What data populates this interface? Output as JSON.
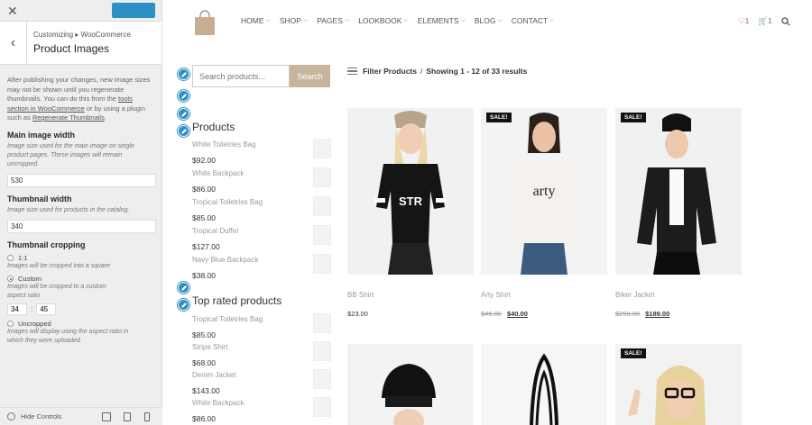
{
  "customizer": {
    "breadcrumb": "Customizing ▸ WooCommerce",
    "section_title": "Product Images",
    "notice_pre": "After publishing your changes, new image sizes may not be shown until you regenerate thumbnails. You can do this from the ",
    "notice_link1": "tools section in WooCommerce",
    "notice_mid": " or by using a plugin such as ",
    "notice_link2": "Regenerate Thumbnails",
    "notice_post": ".",
    "main_image_label": "Main image width",
    "main_image_hint": "Image size used for the main image on single product pages. These images will remain uncropped.",
    "main_image_value": "530",
    "thumb_label": "Thumbnail width",
    "thumb_hint": "Image size used for products in the catalog.",
    "thumb_value": "340",
    "crop_label": "Thumbnail cropping",
    "crop_options": [
      {
        "label": "1:1",
        "hint": "Images will be cropped into a square"
      },
      {
        "label": "Custom",
        "hint": "Images will be cropped to a custom aspect ratio"
      },
      {
        "label": "Uncropped",
        "hint": "Images will display using the aspect ratio in which they were uploaded"
      }
    ],
    "crop_selected": "Custom",
    "ratio_w": "34",
    "ratio_sep": ":",
    "ratio_h": "45",
    "hide_controls": "Hide Controls",
    "accent_color": "#2e8fc7"
  },
  "nav": {
    "items": [
      "HOME",
      "SHOP",
      "PAGES",
      "LOOKBOOK",
      "ELEMENTS",
      "BLOG",
      "CONTACT"
    ],
    "wishlist_count": "♡1",
    "cart_count": "🛒1"
  },
  "search": {
    "placeholder": "Search products...",
    "button": "Search"
  },
  "widgets": {
    "products_title": "Products",
    "products": [
      {
        "name": "White Toiletries Bag",
        "price": "$92.00"
      },
      {
        "name": "White Backpack",
        "price": "$86.00"
      },
      {
        "name": "Tropical Toiletries Bag",
        "price": "$85.00"
      },
      {
        "name": "Tropical Duffel",
        "price": "$127.00"
      },
      {
        "name": "Navy Blue Backpack",
        "price": "$38.00"
      }
    ],
    "top_rated_title": "Top rated products",
    "top_rated": [
      {
        "name": "Tropical Toiletries Bag",
        "price": "$85.00"
      },
      {
        "name": "Stripe Shirt",
        "price": "$68.00"
      },
      {
        "name": "Denim Jacket",
        "price": "$143.00"
      },
      {
        "name": "White Backpack",
        "price": "$86.00"
      }
    ]
  },
  "shop": {
    "filter_label": "Filter Products",
    "filter_sep": "/",
    "results": "Showing 1 - 12 of 33 results",
    "sale_badge": "SALE!",
    "products": [
      {
        "name": "BB Shirt",
        "price": "$23.00",
        "old_price": "",
        "sale": false
      },
      {
        "name": "Arty Shirt",
        "price": "$40.00",
        "old_price": "$45.00",
        "sale": true
      },
      {
        "name": "Biker Jacket",
        "price": "$189.00",
        "old_price": "$250.00",
        "sale": true
      }
    ],
    "arty_print": "arty",
    "bb_print": "STR"
  }
}
